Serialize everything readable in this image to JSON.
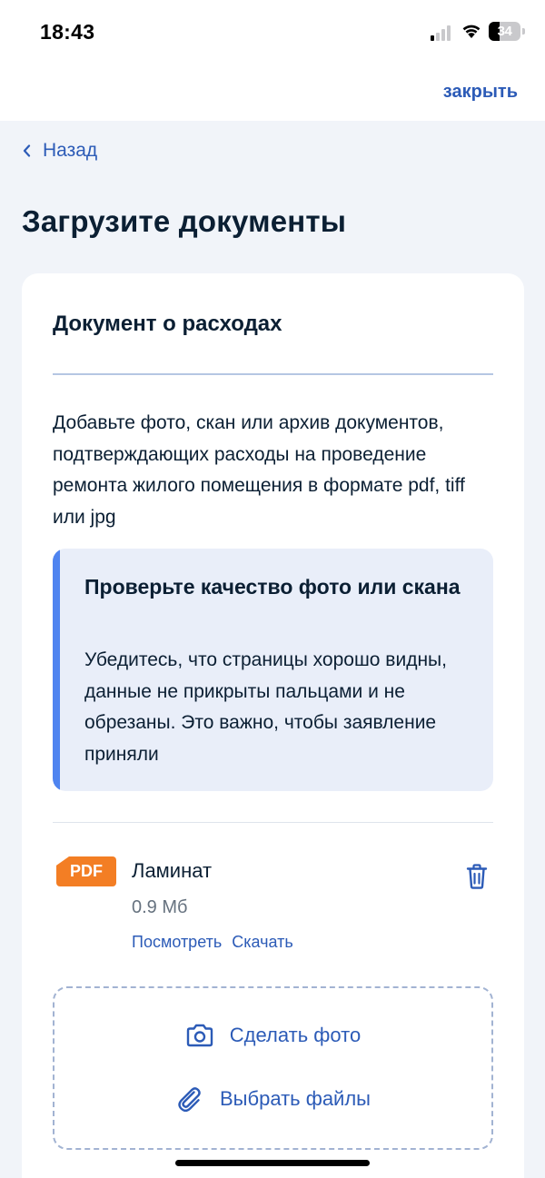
{
  "status_bar": {
    "time": "18:43",
    "battery": "34",
    "battery_level": 0.34
  },
  "header": {
    "close_label": "закрыть",
    "back_label": "Назад"
  },
  "page": {
    "title": "Загрузите документы"
  },
  "card": {
    "title": "Документ о расходах",
    "description": "Добавьте фото, скан или архив документов, подтверждающих расходы на проведение ремонта жилого помещения в формате pdf, tiff или jpg",
    "notice": {
      "title": "Проверьте качество фото или скана",
      "text": "Убедитесь, что страницы хорошо видны, данные не прикрыты пальцами и не обрезаны. Это важно, чтобы заявление приняли"
    },
    "file": {
      "type_badge": "PDF",
      "name": "Ламинат",
      "size": "0.9 Мб",
      "view_label": "Посмотреть",
      "download_label": "Скачать"
    },
    "upload": {
      "take_photo_label": "Сделать фото",
      "choose_files_label": "Выбрать файлы"
    }
  },
  "colors": {
    "accent": "#2c5bb7",
    "notice_bar": "#4f84f0",
    "pdf_badge": "#f37e24",
    "background": "#f1f4f9"
  }
}
